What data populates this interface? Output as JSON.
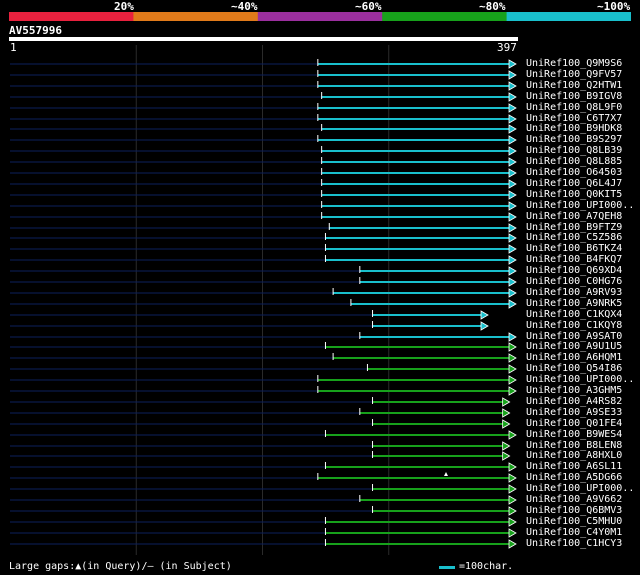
{
  "identity_legend": {
    "segments": [
      {
        "color": "#e8213e"
      },
      {
        "color": "#e07a1a"
      },
      {
        "color": "#9b2f9e"
      },
      {
        "color": "#17a11b"
      },
      {
        "color": "#19bfcc"
      }
    ],
    "labels": [
      "20%",
      "~40%",
      "~60%",
      "~80%",
      "~100%"
    ]
  },
  "query": {
    "id": "AV557996",
    "start_label": "1",
    "end_label": "397"
  },
  "colors": {
    "cyan": "#19bfcc",
    "green": "#17a11b",
    "unaligned": "#0b1f5c",
    "grid": "#2a2a2a"
  },
  "hits": [
    {
      "label": "UniRef100_Q9M9S6",
      "start": 242,
      "end": 397,
      "color": "cyan"
    },
    {
      "label": "UniRef100_Q9FV57",
      "start": 242,
      "end": 397,
      "color": "cyan"
    },
    {
      "label": "UniRef100_Q2HTW1",
      "start": 242,
      "end": 397,
      "color": "cyan"
    },
    {
      "label": "UniRef100_B9IGV8",
      "start": 245,
      "end": 397,
      "color": "cyan"
    },
    {
      "label": "UniRef100_Q8L9F0",
      "start": 242,
      "end": 397,
      "color": "cyan"
    },
    {
      "label": "UniRef100_C6T7X7",
      "start": 242,
      "end": 397,
      "color": "cyan"
    },
    {
      "label": "UniRef100_B9HDK8",
      "start": 245,
      "end": 397,
      "color": "cyan"
    },
    {
      "label": "UniRef100_B9S297",
      "start": 242,
      "end": 397,
      "color": "cyan"
    },
    {
      "label": "UniRef100_Q8LB39",
      "start": 245,
      "end": 397,
      "color": "cyan"
    },
    {
      "label": "UniRef100_Q8L885",
      "start": 245,
      "end": 397,
      "color": "cyan"
    },
    {
      "label": "UniRef100_O64503",
      "start": 245,
      "end": 397,
      "color": "cyan"
    },
    {
      "label": "UniRef100_Q6L4J7",
      "start": 245,
      "end": 397,
      "color": "cyan"
    },
    {
      "label": "UniRef100_Q0KIT5",
      "start": 245,
      "end": 397,
      "color": "cyan"
    },
    {
      "label": "UniRef100_UPI000..",
      "start": 245,
      "end": 397,
      "color": "cyan"
    },
    {
      "label": "UniRef100_A7QEH8",
      "start": 245,
      "end": 397,
      "color": "cyan"
    },
    {
      "label": "UniRef100_B9FTZ9",
      "start": 251,
      "end": 397,
      "color": "cyan"
    },
    {
      "label": "UniRef100_C5Z586",
      "start": 248,
      "end": 397,
      "color": "cyan"
    },
    {
      "label": "UniRef100_B6TKZ4",
      "start": 248,
      "end": 397,
      "color": "cyan"
    },
    {
      "label": "UniRef100_B4FKQ7",
      "start": 248,
      "end": 397,
      "color": "cyan"
    },
    {
      "label": "UniRef100_Q69XD4",
      "start": 275,
      "end": 397,
      "color": "cyan"
    },
    {
      "label": "UniRef100_C0HG76",
      "start": 275,
      "end": 397,
      "color": "cyan"
    },
    {
      "label": "UniRef100_A9RV93",
      "start": 254,
      "end": 397,
      "color": "cyan"
    },
    {
      "label": "UniRef100_A9NRK5",
      "start": 268,
      "end": 397,
      "color": "cyan"
    },
    {
      "label": "UniRef100_C1KQX4",
      "start": 285,
      "end": 375,
      "color": "cyan"
    },
    {
      "label": "UniRef100_C1KQY8",
      "start": 285,
      "end": 375,
      "color": "cyan"
    },
    {
      "label": "UniRef100_A9SAT0",
      "start": 275,
      "end": 397,
      "color": "cyan"
    },
    {
      "label": "UniRef100_A9U1U5",
      "start": 248,
      "end": 397,
      "color": "green"
    },
    {
      "label": "UniRef100_A6HQM1",
      "start": 254,
      "end": 397,
      "color": "green"
    },
    {
      "label": "UniRef100_Q54I86",
      "start": 281,
      "end": 397,
      "color": "green"
    },
    {
      "label": "UniRef100_UPI000..",
      "start": 242,
      "end": 397,
      "color": "green"
    },
    {
      "label": "UniRef100_A3GHM5",
      "start": 242,
      "end": 397,
      "color": "green"
    },
    {
      "label": "UniRef100_A4RS82",
      "start": 285,
      "end": 392,
      "color": "green"
    },
    {
      "label": "UniRef100_A9SE33",
      "start": 275,
      "end": 392,
      "color": "green"
    },
    {
      "label": "UniRef100_Q01FE4",
      "start": 285,
      "end": 392,
      "color": "green"
    },
    {
      "label": "UniRef100_B9WES4",
      "start": 248,
      "end": 397,
      "color": "green"
    },
    {
      "label": "UniRef100_B8LEN8",
      "start": 285,
      "end": 392,
      "color": "green"
    },
    {
      "label": "UniRef100_A8HXL0",
      "start": 285,
      "end": 392,
      "color": "green"
    },
    {
      "label": "UniRef100_A6SL11",
      "start": 248,
      "end": 397,
      "color": "green"
    },
    {
      "label": "UniRef100_A5DG66",
      "start": 242,
      "end": 397,
      "color": "green"
    },
    {
      "label": "UniRef100_UPI000..",
      "start": 285,
      "end": 397,
      "color": "green"
    },
    {
      "label": "UniRef100_A9V662",
      "start": 275,
      "end": 397,
      "color": "green"
    },
    {
      "label": "UniRef100_Q6BMV3",
      "start": 285,
      "end": 397,
      "color": "green"
    },
    {
      "label": "UniRef100_C5MHU0",
      "start": 248,
      "end": 397,
      "color": "green"
    },
    {
      "label": "UniRef100_C4Y0M1",
      "start": 248,
      "end": 397,
      "color": "green"
    },
    {
      "label": "UniRef100_C1HCY3",
      "start": 248,
      "end": 397,
      "color": "green"
    }
  ],
  "footer": {
    "gaps_text": "Large gaps:▲(in Query)/– (in Subject)",
    "scale_text": "=100char."
  }
}
